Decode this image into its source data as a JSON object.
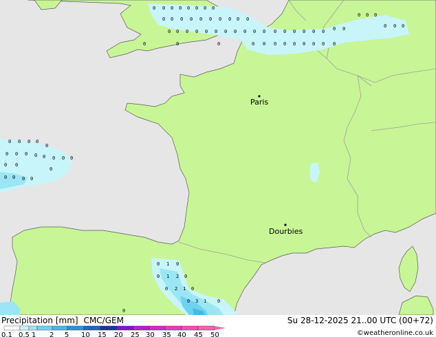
{
  "cities": [
    {
      "name": "Paris"
    },
    {
      "name": "Dourbies"
    }
  ],
  "footer": {
    "left_label": "Precipitation [mm]",
    "model": "CMC/GEM",
    "datetime": "Su 28-12-2025 21..00 UTC (00+72)",
    "credit": "©weatheronline.co.uk"
  },
  "scale": {
    "ticks": [
      "0.1",
      "0.5",
      "1",
      "2",
      "5",
      "10",
      "15",
      "20",
      "25",
      "30",
      "35",
      "40",
      "45",
      "50"
    ],
    "colors": [
      "#ffffff",
      "#c8f5fa",
      "#9be6f5",
      "#6ed2f0",
      "#46b9e6",
      "#2896dc",
      "#1e64c8",
      "#1e32a0",
      "#8214c8",
      "#b41ed2",
      "#d228c8",
      "#e63cbe",
      "#f050b4",
      "#f064aa"
    ]
  },
  "colors": {
    "land": "#c8f596",
    "sea": "#e6e6e6",
    "precip_light": "#c8f5fa",
    "precip_mid": "#9be6f5",
    "precip_heavy": "#46b9e6",
    "border": "#a0a0a0",
    "coast": "#5a5a5a"
  },
  "precip_values": [
    "0",
    "1",
    "2",
    "3"
  ]
}
